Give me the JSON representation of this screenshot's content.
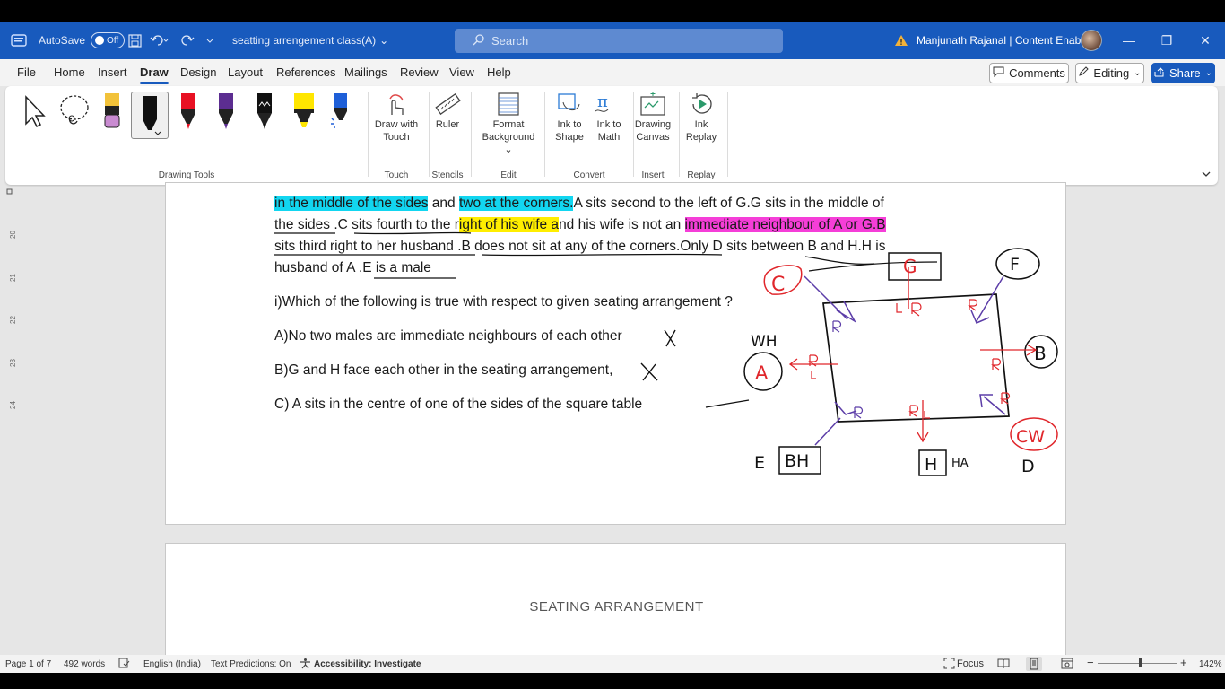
{
  "titlebar": {
    "autosave_label": "AutoSave",
    "autosave_state": "Off",
    "document_title": "seatting arrengement class(A)",
    "search_placeholder": "Search",
    "user_name": "Manjunath Rajanal | Content Enablers"
  },
  "menu": {
    "tabs": [
      "File",
      "Home",
      "Insert",
      "Draw",
      "Design",
      "Layout",
      "References",
      "Mailings",
      "Review",
      "View",
      "Help"
    ],
    "comments_label": "Comments",
    "editing_label": "Editing",
    "share_label": "Share"
  },
  "ribbon": {
    "groups": {
      "drawing_tools": "Drawing Tools",
      "touch": "Touch",
      "stencils": "Stencils",
      "edit": "Edit",
      "convert": "Convert",
      "insert": "Insert",
      "replay": "Replay"
    },
    "buttons": {
      "draw_with_touch": [
        "Draw with",
        "Touch"
      ],
      "ruler": "Ruler",
      "format_background": [
        "Format",
        "Background"
      ],
      "ink_to_shape": [
        "Ink to",
        "Shape"
      ],
      "ink_to_math": [
        "Ink to",
        "Math"
      ],
      "drawing_canvas": [
        "Drawing",
        "Canvas"
      ],
      "ink_replay": [
        "Ink",
        "Replay"
      ]
    },
    "pen_colors": [
      "#000000",
      "#e81123",
      "#5c2d91",
      "#000000",
      "#ffe600",
      "#1e5fd8"
    ]
  },
  "document": {
    "line1_parts": [
      "in the middle of the sides",
      " and ",
      "two at the corners.",
      "A sits second to the left of G.G sits in the middle of"
    ],
    "line2_parts": [
      "the sides",
      " .C sits fourth to the r",
      "ight of his wife a",
      "nd his wife is not an ",
      "immediate neighbour of A or G.B"
    ],
    "line3": "sits third right to her husband .B does not sit at any of the corners.Only D sits between B and H.H is",
    "line4": "husband of A .E is a male",
    "question": "i)Which of the following is true with respect to given seating arrangement ?",
    "option_a": "A)No two males are immediate neighbours of each other",
    "option_b": "B)G and H face each other in the seating arrangement,",
    "option_c": "C) A sits in the centre of one of the sides of the square table",
    "page2_heading": "SEATING ARRANGEMENT"
  },
  "ink_labels": {
    "corner_top_left": "C",
    "top_mid": "G",
    "corner_top_right": "F",
    "right_mid": "B",
    "corner_bottom_right": "CW",
    "corner_bottom_right_outer": "D",
    "left_mid": "A",
    "left_mid_note": "WH",
    "corner_bottom_left": "BH",
    "corner_bottom_left_outer": "E",
    "bottom_mid": "H",
    "bottom_mid_note": "HA"
  },
  "status": {
    "page": "Page 1 of 7",
    "words": "492 words",
    "language": "English (India)",
    "text_predictions": "Text Predictions: On",
    "accessibility": "Accessibility: Investigate",
    "focus": "Focus",
    "zoom": "142%"
  }
}
